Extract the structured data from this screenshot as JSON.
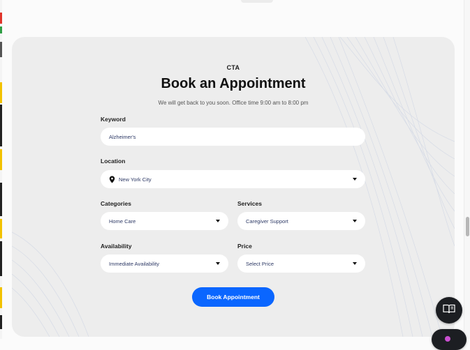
{
  "section": {
    "eyebrow": "CTA",
    "title": "Book an Appointment",
    "subtitle": "We will get back to you soon. Office time 9:00 am to 8:00 pm"
  },
  "form": {
    "keyword": {
      "label": "Keyword",
      "value": "Alzheimer's"
    },
    "location": {
      "label": "Location",
      "value": "New York City"
    },
    "categories": {
      "label": "Categories",
      "value": "Home Care"
    },
    "services": {
      "label": "Services",
      "value": "Caregiver Support"
    },
    "availability": {
      "label": "Availability",
      "value": "Immediate Availability"
    },
    "price": {
      "label": "Price",
      "value": "Select Price"
    },
    "submit_label": "Book Appointment"
  },
  "icons": {
    "location": "map-pin-icon",
    "dropdown": "chevron-down-icon",
    "reader": "book-open-icon",
    "chat": "chat-icon"
  },
  "colors": {
    "accent": "#0a66ff",
    "card_background": "#ededed",
    "field_text": "#2e3a66",
    "floating_button": "#1c1e22"
  }
}
